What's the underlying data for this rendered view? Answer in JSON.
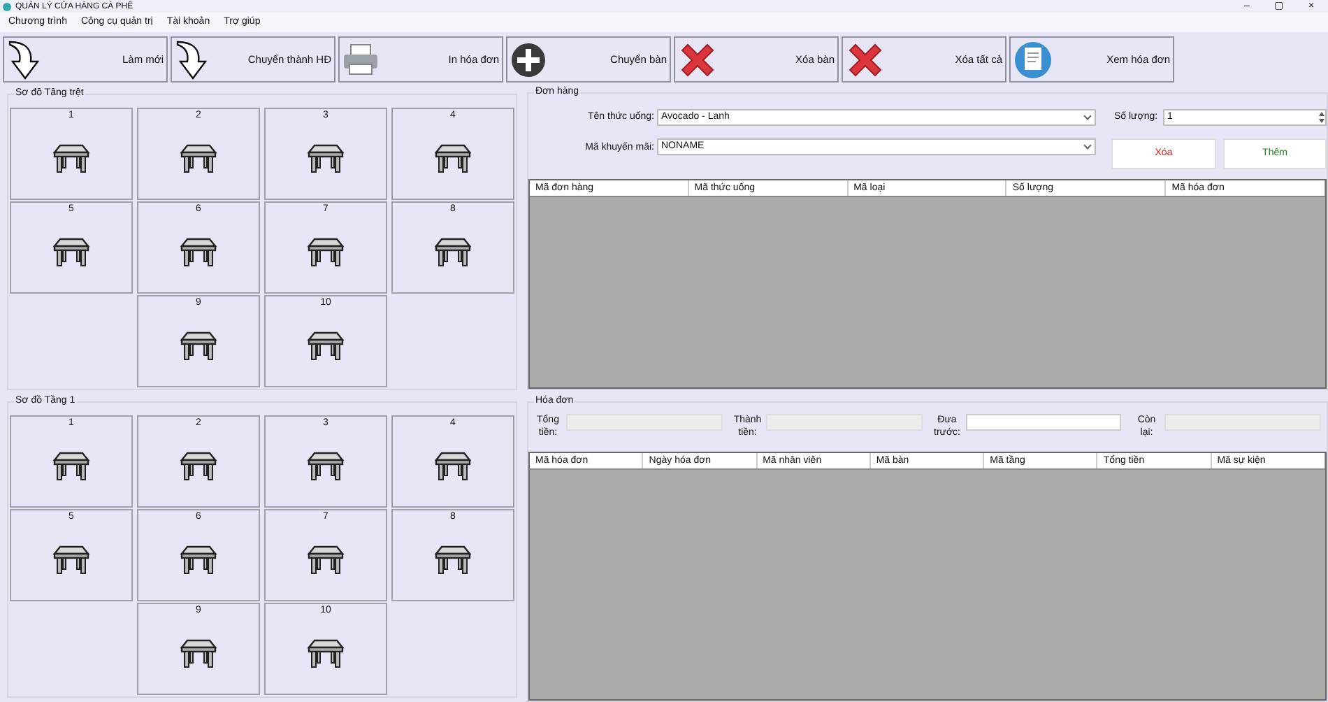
{
  "window": {
    "title": "QUẢN LÝ CỬA HÀNG CÀ PHÊ",
    "controls": [
      "–",
      "▢",
      "×"
    ]
  },
  "menu": [
    "Chương trình",
    "Công cụ quản trị",
    "Tài khoản",
    "Trợ giúp"
  ],
  "toolbar": [
    {
      "label": "Làm mới",
      "kind": "arrow"
    },
    {
      "label": "Chuyển thành HĐ",
      "kind": "arrow"
    },
    {
      "label": "In hóa đơn",
      "kind": "printer"
    },
    {
      "label": "Chuyển bàn",
      "kind": "plus"
    },
    {
      "label": "Xóa bàn",
      "kind": "cross"
    },
    {
      "label": "Xóa tất cả",
      "kind": "cross"
    },
    {
      "label": "Xem hóa đơn",
      "kind": "receipt"
    }
  ],
  "floors": [
    {
      "title": "Sơ đồ Tầng trệt",
      "tables": [
        "1",
        "2",
        "3",
        "4",
        "5",
        "6",
        "7",
        "8",
        "9",
        "10"
      ]
    },
    {
      "title": "Sơ đồ Tầng 1",
      "tables": [
        "1",
        "2",
        "3",
        "4",
        "5",
        "6",
        "7",
        "8",
        "9",
        "10"
      ]
    }
  ],
  "order": {
    "title": "Đơn hàng",
    "drink_label": "Tên thức uống:",
    "drink": "Avocado - Lanh",
    "quantity_label": "Số lượng:",
    "quantity": "1",
    "promo_label": "Mã khuyến mãi:",
    "promo": "NONAME",
    "delete_button": "Xóa",
    "add_button": "Thêm",
    "table": {
      "columns": [
        "Mã đơn hàng",
        "Mã thức uống",
        "Mã loại",
        "Số lượng",
        "Mã hóa đơn"
      ]
    }
  },
  "invoice": {
    "title": "Hóa đơn",
    "fields": [
      {
        "label": "Tổng tiền:",
        "editable": false
      },
      {
        "label": "Thành tiền:",
        "editable": false
      },
      {
        "label": "Đưa trước:",
        "editable": true
      },
      {
        "label": "Còn lại:",
        "editable": false
      }
    ],
    "table": {
      "columns": [
        "Mã hóa đơn",
        "Ngày hóa đơn",
        "Mã nhân viên",
        "Mã bàn",
        "Mã tầng",
        "Tổng tiền",
        "Mã sự kiện"
      ]
    }
  }
}
